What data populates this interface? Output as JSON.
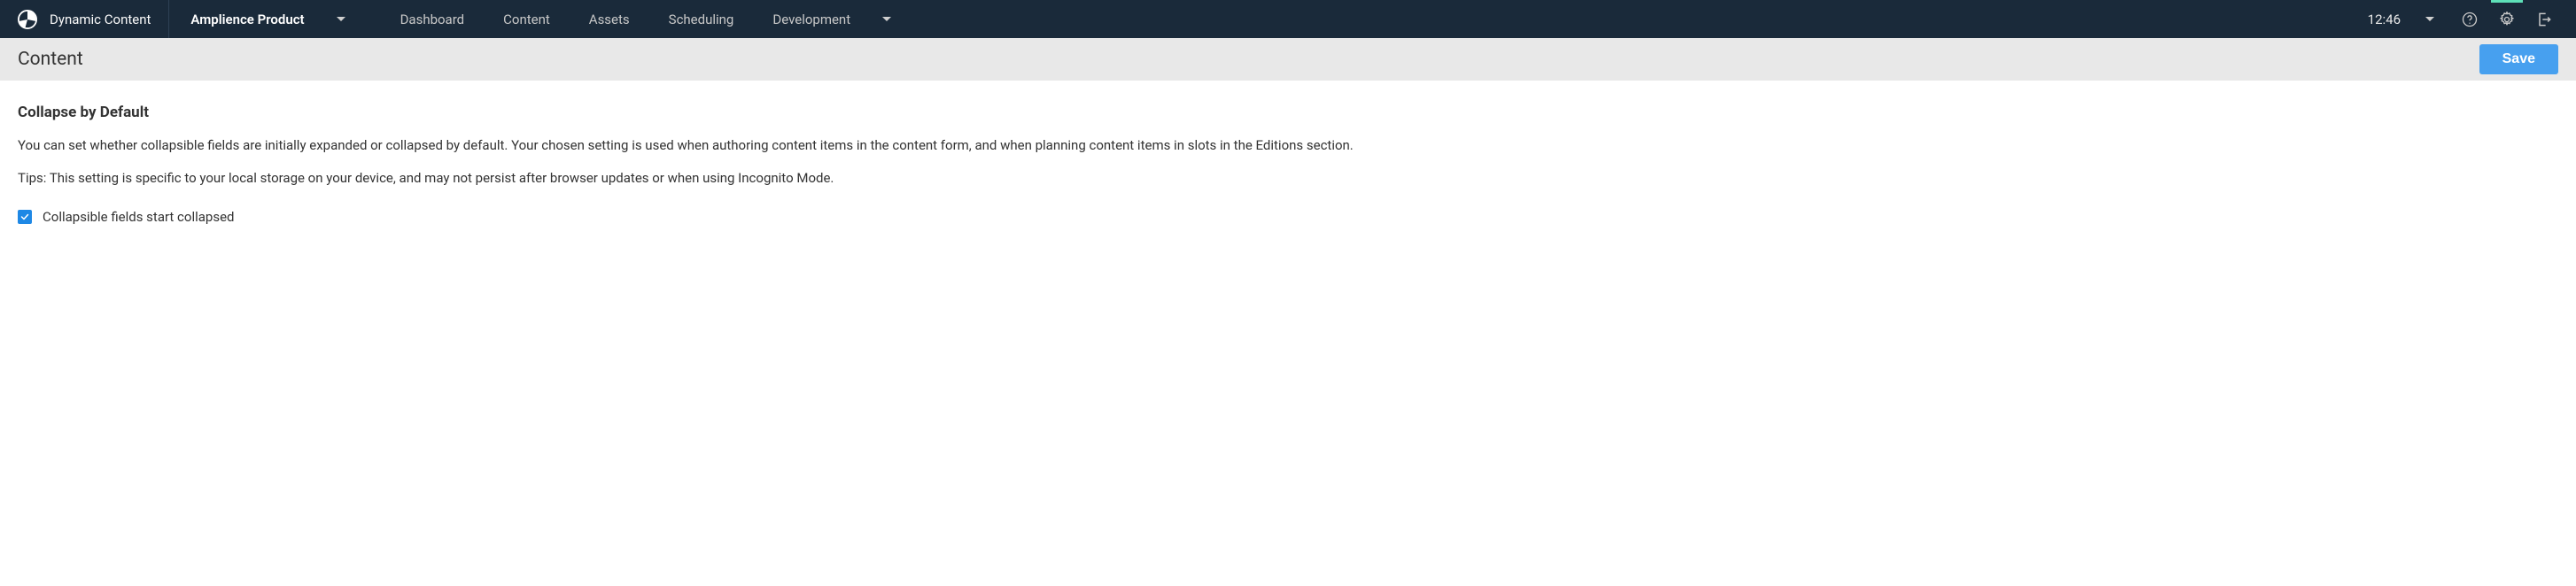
{
  "header": {
    "brand": "Dynamic Content",
    "hub": "Amplience Product",
    "nav": [
      "Dashboard",
      "Content",
      "Assets",
      "Scheduling",
      "Development"
    ],
    "time": "12:46"
  },
  "subheader": {
    "title": "Content",
    "save_label": "Save"
  },
  "settings": {
    "heading": "Collapse by Default",
    "description": "You can set whether collapsible fields are initially expanded or collapsed by default. Your chosen setting is used when authoring content items in the content form, and when planning content items in slots in the Editions section.",
    "tips": "Tips: This setting is specific to your local storage on your device, and may not persist after browser updates or when using Incognito Mode.",
    "checkbox_label": "Collapsible fields start collapsed",
    "checkbox_checked": true
  }
}
